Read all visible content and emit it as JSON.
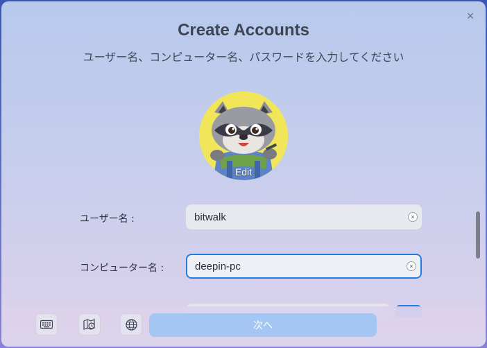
{
  "window": {
    "title": "Create Accounts",
    "subtitle": "ユーザー名、コンピューター名、パスワードを入力してください",
    "close_icon": "×"
  },
  "avatar": {
    "edit_label": "Edit"
  },
  "form": {
    "username": {
      "label": "ユーザー名 :",
      "value": "bitwalk"
    },
    "computer_name": {
      "label": "コンピューター名 :",
      "value": "deepin-pc"
    },
    "clear_icon": "×"
  },
  "footer": {
    "keyboard_icon": "keyboard-icon",
    "timezone_icon": "map-clock-icon",
    "language_icon": "globe-icon",
    "next_label": "次へ"
  },
  "colors": {
    "accent": "#1f7ce4",
    "next_button": "#a5c5f3"
  }
}
